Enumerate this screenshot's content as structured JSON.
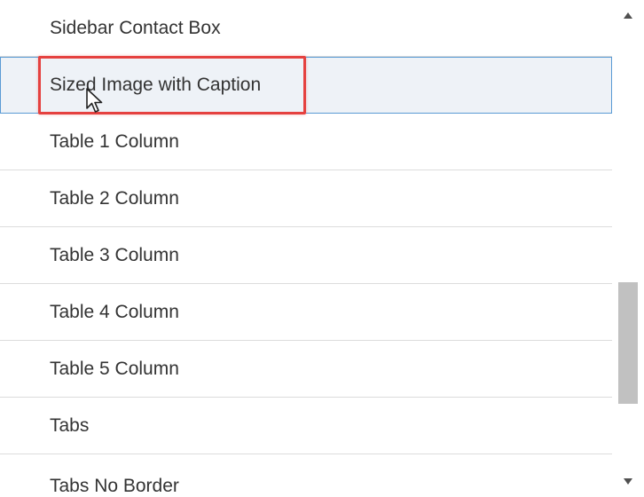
{
  "list": {
    "items": [
      {
        "label": "Sidebar Contact Box"
      },
      {
        "label": "Sized Image with Caption"
      },
      {
        "label": "Table 1 Column"
      },
      {
        "label": "Table 2 Column"
      },
      {
        "label": "Table 3 Column"
      },
      {
        "label": "Table 4 Column"
      },
      {
        "label": "Table 5 Column"
      },
      {
        "label": "Tabs"
      },
      {
        "label": "Tabs No Border"
      }
    ],
    "selected_label": "Sized Image with Caption"
  },
  "icons": {
    "scroll_up": "triangle-up-icon",
    "scroll_down": "triangle-down-icon",
    "cursor": "arrow-cursor-icon"
  },
  "colors": {
    "selected_background": "#eef2f7",
    "selected_border": "#5a9bd5",
    "highlight": "#e5413f",
    "scroll_thumb": "#c1c1c1",
    "text": "#333333",
    "divider": "#dcdcdc"
  }
}
